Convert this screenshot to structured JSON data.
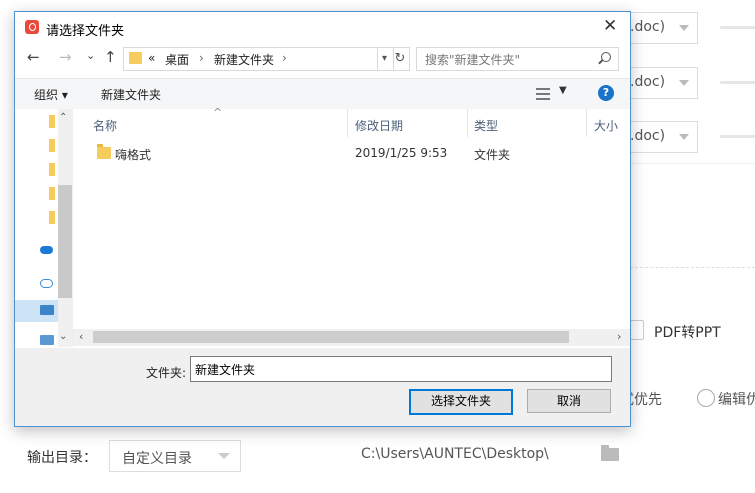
{
  "background": {
    "format_rows": [
      {
        "text": ".doc)"
      },
      {
        "text": ".doc)"
      },
      {
        "text": ".doc)"
      }
    ],
    "pdf_to_ppt": "PDF转PPT",
    "priority_left": "式优先",
    "priority_right": "编辑优",
    "output_label": "输出目录：",
    "output_select": "自定义目录",
    "output_path": "C:\\Users\\AUNTEC\\Desktop\\"
  },
  "dialog": {
    "title": "请选择文件夹",
    "nav": {
      "back": "←",
      "forward": "→",
      "recent": "⌄",
      "up": "↑",
      "breadcrumb_overflow": "«",
      "breadcrumb": [
        "桌面",
        "新建文件夹"
      ],
      "search_placeholder": "搜索\"新建文件夹\""
    },
    "toolbar": {
      "organize": "组织 ▾",
      "new_folder": "新建文件夹"
    },
    "columns": [
      "名称",
      "修改日期",
      "类型",
      "大小"
    ],
    "files": [
      {
        "name": "嗨格式",
        "modified": "2019/1/25 9:53",
        "type": "文件夹"
      }
    ],
    "folder_label": "文件夹:",
    "folder_value": "新建文件夹",
    "select_button": "选择文件夹",
    "cancel_button": "取消"
  },
  "colors": {
    "accent": "#0078d7",
    "folder": "#f6cd5d",
    "dialog_border": "#4c93cf"
  }
}
